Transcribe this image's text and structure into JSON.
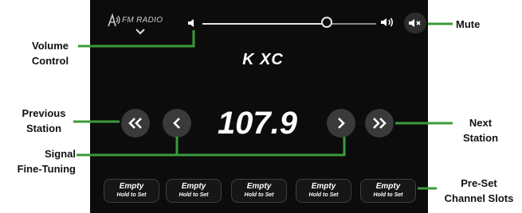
{
  "source": {
    "label": "FM RADIO",
    "icon": "radio-antenna-icon"
  },
  "station": {
    "name": "K XC",
    "frequency": "107.9"
  },
  "volume": {
    "level": 0.72
  },
  "presets": [
    {
      "title": "Empty",
      "subtitle": "Hold to Set"
    },
    {
      "title": "Empty",
      "subtitle": "Hold to Set"
    },
    {
      "title": "Empty",
      "subtitle": "Hold to Set"
    },
    {
      "title": "Empty",
      "subtitle": "Hold to Set"
    },
    {
      "title": "Empty",
      "subtitle": "Hold to Set"
    }
  ],
  "callouts": {
    "volume_control": [
      "Volume",
      "Control"
    ],
    "mute": "Mute",
    "previous_station": [
      "Previous",
      "Station"
    ],
    "next_station": [
      "Next",
      "Station"
    ],
    "signal_fine_tuning": [
      "Signal",
      "Fine-Tuning"
    ],
    "preset_slots": [
      "Pre-Set",
      "Channel Slots"
    ]
  },
  "colors": {
    "screen_bg": "#0c0c0c",
    "button_bg": "#3a3a3a",
    "callout_line": "#3a9b3a",
    "text": "#ffffff"
  }
}
